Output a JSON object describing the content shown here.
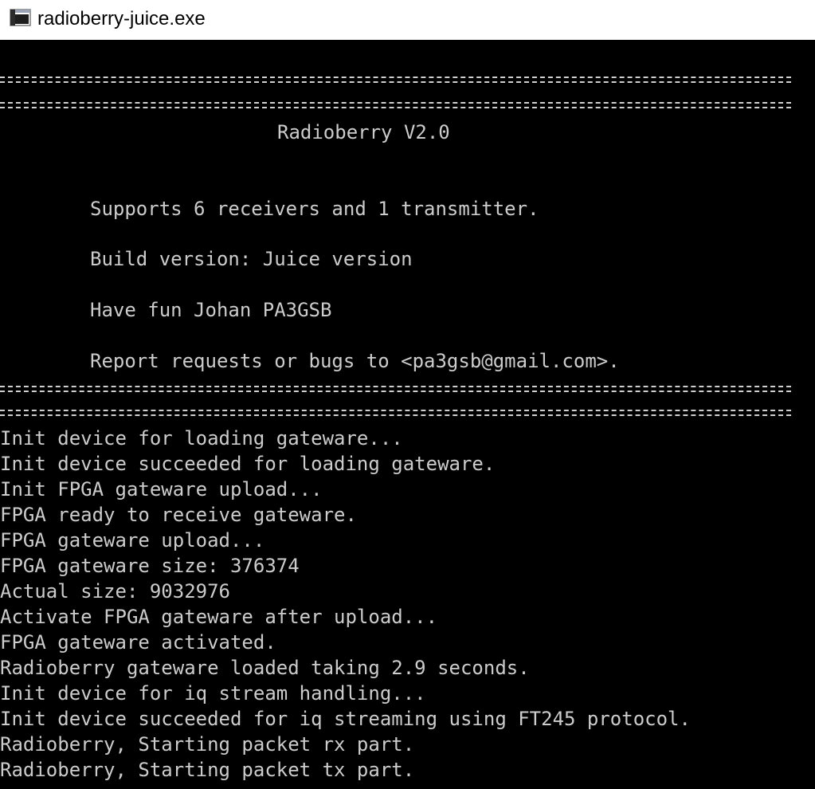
{
  "window": {
    "title": "radioberry-juice.exe",
    "icon": "console-app-icon"
  },
  "console": {
    "header": {
      "title": "Radioberry V2.0",
      "supports": "Supports 6 receivers and 1 transmitter.",
      "build": "Build version: Juice version",
      "greeting": "Have fun Johan PA3GSB",
      "report": "Report requests or bugs to <pa3gsb@gmail.com>."
    },
    "log": [
      "Init device for loading gateware...",
      "Init device succeeded for loading gateware.",
      "Init FPGA gateware upload...",
      "FPGA ready to receive gateware.",
      "FPGA gateware upload...",
      "FPGA gateware size: 376374",
      "Actual size: 9032976",
      "Activate FPGA gateware after upload...",
      "FPGA gateware activated.",
      "Radioberry gateware loaded taking 2.9 seconds.",
      "Init device for iq stream handling...",
      "Init device succeeded for iq streaming using FT245 protocol.",
      "Radioberry, Starting packet rx part.",
      "Radioberry, Starting packet tx part."
    ]
  }
}
